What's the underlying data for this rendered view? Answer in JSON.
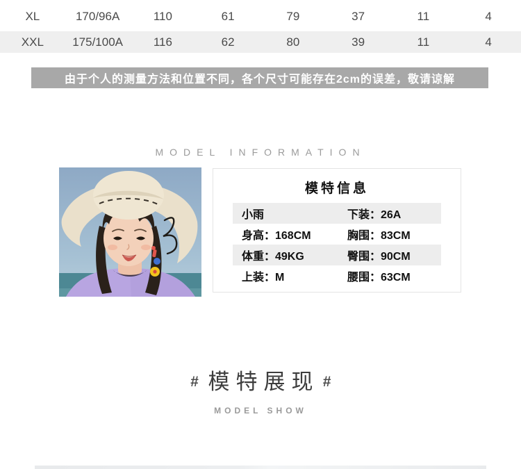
{
  "size_table": {
    "rows": [
      {
        "cells": [
          "XL",
          "170/96A",
          "110",
          "61",
          "79",
          "37",
          "11",
          "4"
        ]
      },
      {
        "cells": [
          "XXL",
          "175/100A",
          "116",
          "62",
          "80",
          "39",
          "11",
          "4"
        ]
      }
    ]
  },
  "notice_banner": {
    "text": "由于个人的测量方法和位置不同，各个尺寸可能存在2cm的误差，敬请谅解",
    "background_color": "#a8a8a8",
    "text_color": "#ffffff"
  },
  "model_info_section": {
    "heading_en": "MODEL INFORMATION",
    "photo_alt": "model wearing straw sun hat",
    "card": {
      "title": "模特信息",
      "rows": [
        {
          "left": "小雨",
          "right": "下装：26A"
        },
        {
          "left": "身高：168CM",
          "right": "胸围：83CM"
        },
        {
          "left": "体重：49KG",
          "right": "臀围：90CM"
        },
        {
          "left": "上装：M",
          "right": "腰围：63CM"
        }
      ],
      "stripe_color": "#ededed"
    }
  },
  "model_show_section": {
    "hash_left": "#",
    "heading_cn": "模特展现",
    "hash_right": "#",
    "heading_en": "MODEL SHOW"
  }
}
